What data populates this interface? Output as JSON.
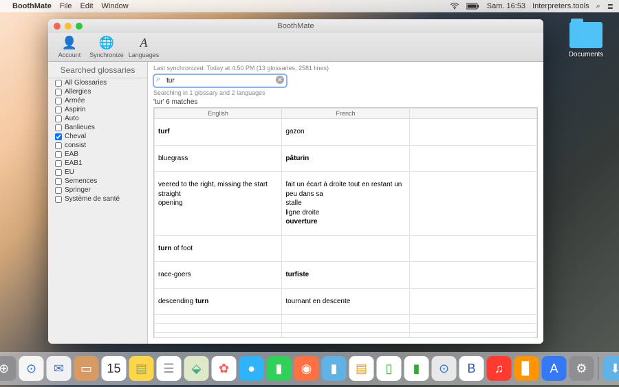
{
  "menubar": {
    "app": "BoothMate",
    "items": [
      "File",
      "Edit",
      "Window"
    ],
    "right": {
      "time": "Sam. 16:53",
      "siteName": "Interpreters.tools"
    }
  },
  "desktop": {
    "documents": "Documents"
  },
  "window": {
    "title": "BoothMate",
    "toolbar": {
      "account": "Account",
      "sync": "Synchronize",
      "lang": "Languages"
    },
    "sidebar": {
      "title": "Searched glossaries",
      "items": [
        {
          "label": "All Glossaries",
          "checked": false
        },
        {
          "label": "Allergies",
          "checked": false
        },
        {
          "label": "Armée",
          "checked": false
        },
        {
          "label": "Aspirin",
          "checked": false
        },
        {
          "label": "Auto",
          "checked": false
        },
        {
          "label": "Banlieues",
          "checked": false
        },
        {
          "label": "Cheval",
          "checked": true
        },
        {
          "label": "consist",
          "checked": false
        },
        {
          "label": "EAB",
          "checked": false
        },
        {
          "label": "EAB1",
          "checked": false
        },
        {
          "label": "EU",
          "checked": false
        },
        {
          "label": "Semences",
          "checked": false
        },
        {
          "label": "Springer",
          "checked": false
        },
        {
          "label": "Système de santé",
          "checked": false
        }
      ]
    },
    "main": {
      "syncLine": "Last synchronized: Today at 4:50 PM (13 glossaries, 2581 lines)",
      "searchValue": "tur",
      "searchPlaceholder": "",
      "hint": "Searching in 1 glossary and 2 languages",
      "matchesLabel": "'tur' 6 matches",
      "columns": [
        "English",
        "French",
        ""
      ],
      "rows": [
        {
          "en": "<b>turf</b>",
          "fr": "gazon",
          "c3": ""
        },
        {
          "en": "bluegrass",
          "fr": "<b>pâturin</b>",
          "c3": ""
        },
        {
          "en": "veered to the right, missing the start<br>straight<br>opening",
          "fr": "fait un écart à droite tout en restant un peu dans sa<br>stalle<br>ligne droite<br><b>ouverture</b>",
          "c3": ""
        },
        {
          "en": "<b>turn</b> of foot",
          "fr": "",
          "c3": ""
        },
        {
          "en": "race-goers",
          "fr": "<b>turfiste</b>",
          "c3": ""
        },
        {
          "en": "descending <b>turn</b>",
          "fr": "tournant en descente",
          "c3": ""
        }
      ],
      "emptyRows": 7
    }
  },
  "dock": {
    "icons": [
      {
        "name": "finder",
        "bg": "#29abe2",
        "glyph": "☻"
      },
      {
        "name": "launchpad",
        "bg": "#8e8e93",
        "glyph": "⊕"
      },
      {
        "name": "safari",
        "bg": "#f6f6f6",
        "glyph": "⊙",
        "fg": "#2a7ad4"
      },
      {
        "name": "mail",
        "bg": "#f1f1f3",
        "glyph": "✉",
        "fg": "#3478f6"
      },
      {
        "name": "contacts",
        "bg": "#d89a63",
        "glyph": "▭"
      },
      {
        "name": "calendar",
        "bg": "#ffffff",
        "glyph": "15",
        "fg": "#333"
      },
      {
        "name": "notes",
        "bg": "#ffd54a",
        "glyph": "▤",
        "fg": "#8a6"
      },
      {
        "name": "reminders",
        "bg": "#ffffff",
        "glyph": "☰",
        "fg": "#888"
      },
      {
        "name": "maps",
        "bg": "#dfe8c8",
        "glyph": "⬙",
        "fg": "#4a8"
      },
      {
        "name": "photos",
        "bg": "#ffffff",
        "glyph": "✿",
        "fg": "#f55"
      },
      {
        "name": "messages",
        "bg": "#2fb4f9",
        "glyph": "●"
      },
      {
        "name": "facetime",
        "bg": "#30d158",
        "glyph": "▮"
      },
      {
        "name": "photobooth",
        "bg": "#ff7043",
        "glyph": "◉"
      },
      {
        "name": "folder1",
        "bg": "#5fb1e6",
        "glyph": "▮"
      },
      {
        "name": "pages",
        "bg": "#ffffff",
        "glyph": "▤",
        "fg": "#f90"
      },
      {
        "name": "numbers",
        "bg": "#ffffff",
        "glyph": "▯",
        "fg": "#3a3"
      },
      {
        "name": "numbers2",
        "bg": "#ffffff",
        "glyph": "▮",
        "fg": "#3a3"
      },
      {
        "name": "safari2",
        "bg": "#e8e8e8",
        "glyph": "⊙",
        "fg": "#2a7ad4"
      },
      {
        "name": "boothmate",
        "bg": "#ffffff",
        "glyph": "B",
        "fg": "#2358b8"
      },
      {
        "name": "itunes",
        "bg": "#ff3b30",
        "glyph": "♫"
      },
      {
        "name": "ibooks",
        "bg": "#ff9500",
        "glyph": "▊"
      },
      {
        "name": "appstore",
        "bg": "#3478f6",
        "glyph": "A"
      },
      {
        "name": "settings",
        "bg": "#8e8e93",
        "glyph": "⚙"
      }
    ],
    "right": [
      {
        "name": "downloads",
        "bg": "#5fb1e6",
        "glyph": "⬇"
      },
      {
        "name": "trash",
        "bg": "#ececec",
        "glyph": "🗑",
        "fg": "#999"
      }
    ]
  }
}
